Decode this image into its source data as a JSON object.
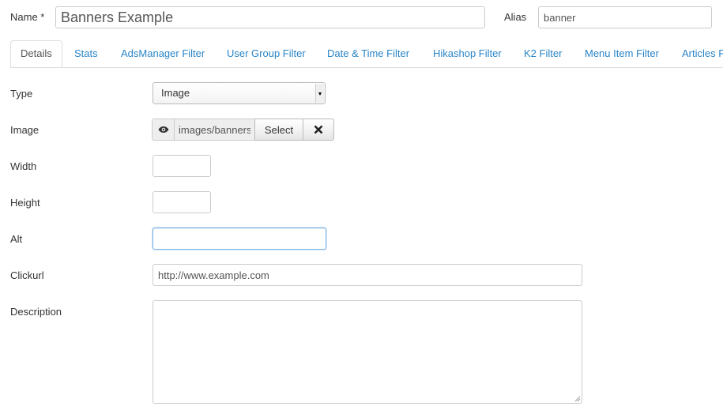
{
  "header": {
    "name_label": "Name *",
    "name_value": "Banners Example",
    "alias_label": "Alias",
    "alias_value": "banner"
  },
  "tabs": [
    {
      "label": "Details",
      "active": true
    },
    {
      "label": "Stats"
    },
    {
      "label": "AdsManager Filter"
    },
    {
      "label": "User Group Filter"
    },
    {
      "label": "Date & Time Filter"
    },
    {
      "label": "Hikashop Filter"
    },
    {
      "label": "K2 Filter"
    },
    {
      "label": "Menu Item Filter"
    },
    {
      "label": "Articles F"
    }
  ],
  "form": {
    "type_label": "Type",
    "type_value": "Image",
    "image_label": "Image",
    "image_path": "images/banners",
    "select_button": "Select",
    "clear_icon": "close-icon",
    "preview_icon": "eye-icon",
    "width_label": "Width",
    "width_value": "",
    "height_label": "Height",
    "height_value": "",
    "alt_label": "Alt",
    "alt_value": "",
    "clickurl_label": "Clickurl",
    "clickurl_value": "http://www.example.com",
    "description_label": "Description",
    "description_value": ""
  },
  "colors": {
    "tab_link": "#2a85c7",
    "focus_border": "#7fb3e6"
  }
}
